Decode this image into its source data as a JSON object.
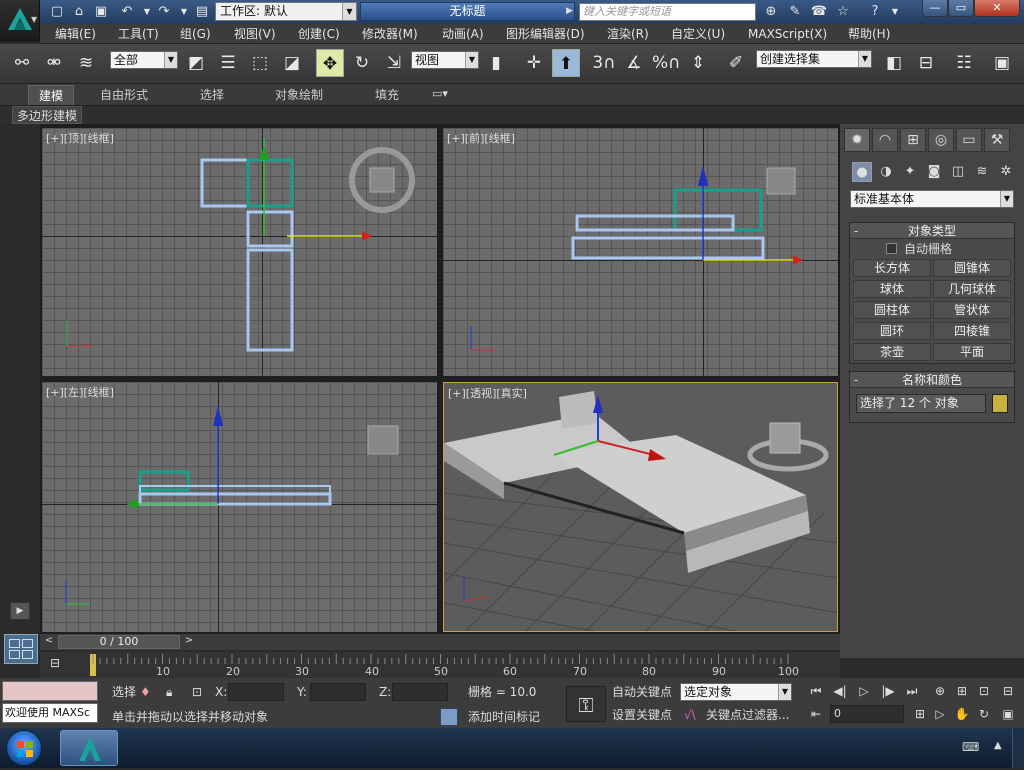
{
  "titlebar": {
    "workspace_label": "工作区: 默认",
    "doc_title": "无标题",
    "search_placeholder": "键入关键字或短语"
  },
  "menubar": {
    "items": [
      "编辑(E)",
      "工具(T)",
      "组(G)",
      "视图(V)",
      "创建(C)",
      "修改器(M)",
      "动画(A)",
      "图形编辑器(D)",
      "渲染(R)",
      "自定义(U)",
      "MAXScript(X)",
      "帮助(H)"
    ]
  },
  "toolbar": {
    "filter_value": "全部",
    "coord_value": "视图",
    "named_selection": "创建选择集",
    "snap_3": "3",
    "snap_pct": "%"
  },
  "ribbon": {
    "tabs": [
      "建模",
      "自由形式",
      "选择",
      "对象绘制",
      "填充"
    ],
    "sub_label": "多边形建模"
  },
  "viewports": {
    "top": {
      "label": "[+][顶][线框]"
    },
    "front": {
      "label": "[+][前][线框]"
    },
    "left": {
      "label": "[+][左][线框]"
    },
    "persp": {
      "label": "[+][透视][真实]"
    }
  },
  "cmdpanel": {
    "category": "标准基本体",
    "object_type_title": "对象类型",
    "autogrid_label": "自动栅格",
    "objects": [
      "长方体",
      "圆锥体",
      "球体",
      "几何球体",
      "圆柱体",
      "管状体",
      "圆环",
      "四棱锥",
      "茶壶",
      "平面"
    ],
    "name_color_title": "名称和颜色",
    "name_value": "选择了 12 个 对象",
    "name_color_swatch": "#c8b340"
  },
  "timeline": {
    "frame_label": "0 / 100",
    "ticks": [
      "10",
      "20",
      "30",
      "40",
      "50",
      "60",
      "70",
      "80",
      "90",
      "100"
    ]
  },
  "statusbar": {
    "welcome": "欢迎使用 MAXSc",
    "select_label": "选择",
    "x_label": "X:",
    "y_label": "Y:",
    "z_label": "Z:",
    "grid_label": "栅格 = 10.0",
    "prompt": "单击并拖动以选择并移动对象",
    "add_time_tag": "添加时间标记",
    "auto_key": "自动关键点",
    "set_key": "设置关键点",
    "key_mode_value": "选定对象",
    "key_filter": "关键点过滤器...",
    "frame_value": "0"
  }
}
